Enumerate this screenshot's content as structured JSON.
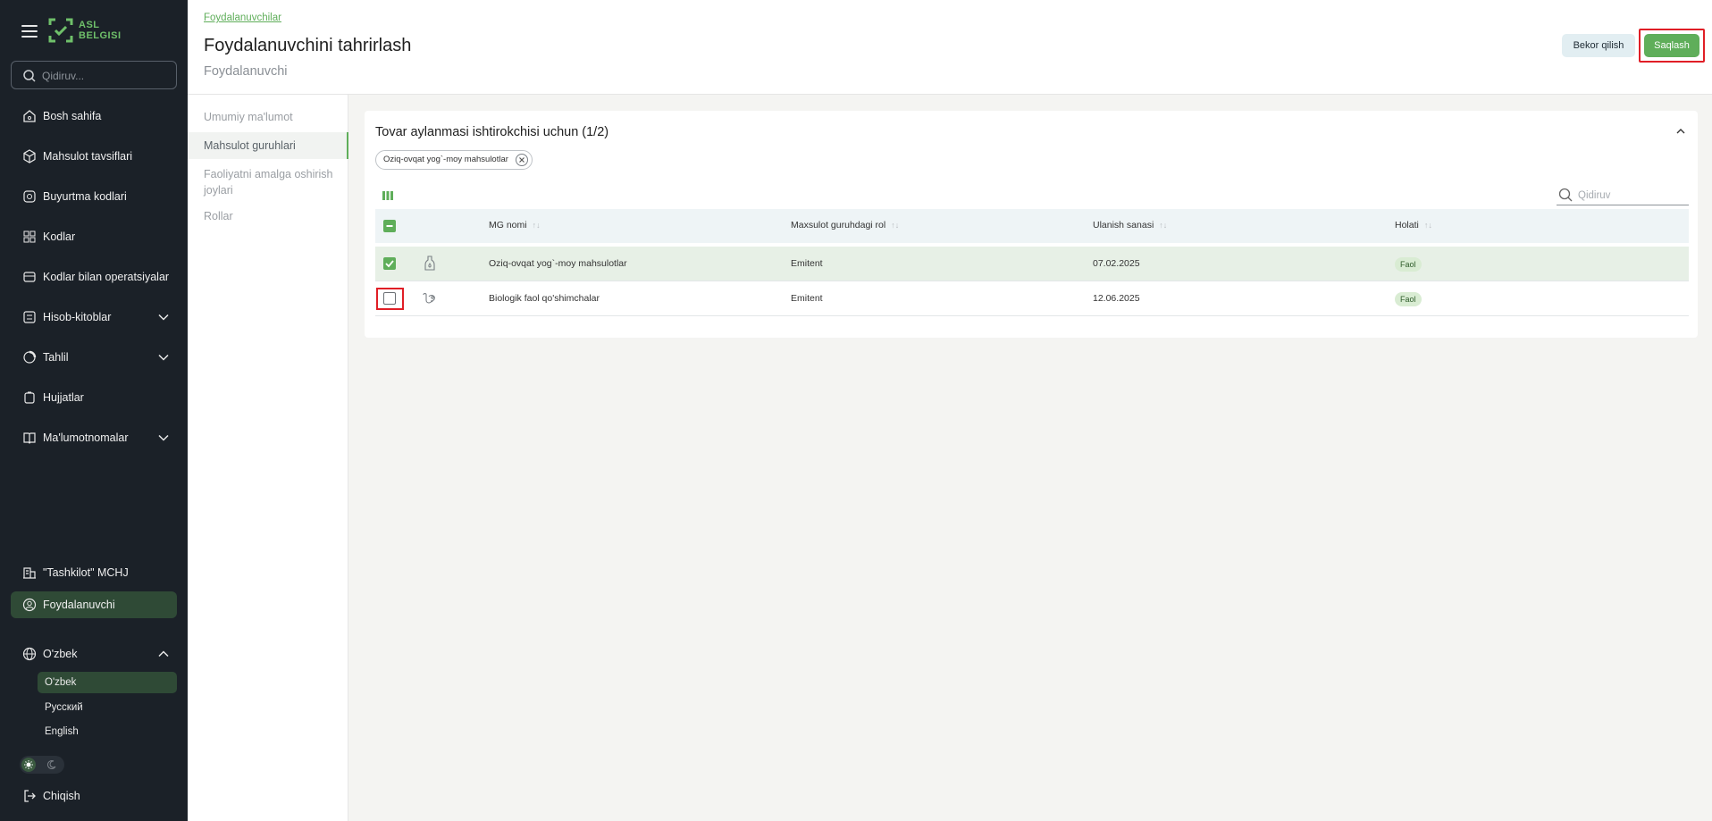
{
  "sidebar": {
    "logo": {
      "line1": "ASL",
      "line2": "BELGISI"
    },
    "search_placeholder": "Qidiruv...",
    "items": [
      {
        "label": "Bosh sahifa"
      },
      {
        "label": "Mahsulot tavsiflari"
      },
      {
        "label": "Buyurtma kodlari"
      },
      {
        "label": "Kodlar"
      },
      {
        "label": "Kodlar bilan operatsiyalar"
      },
      {
        "label": "Hisob-kitoblar"
      },
      {
        "label": "Tahlil"
      },
      {
        "label": "Hujjatlar"
      },
      {
        "label": "Ma'lumotnomalar"
      }
    ],
    "organization": "\"Tashkilot\" MCHJ",
    "user": "Foydalanuvchi",
    "language": {
      "current": "O'zbek",
      "options": [
        "O'zbek",
        "Русский",
        "English"
      ]
    },
    "logout": "Chiqish"
  },
  "header": {
    "breadcrumb": "Foydalanuvchilar",
    "title": "Foydalanuvchini tahrirlash",
    "subtitle": "Foydalanuvchi",
    "cancel_label": "Bekor qilish",
    "save_label": "Saqlash"
  },
  "subnav": {
    "items": [
      {
        "label": "Umumiy ma'lumot"
      },
      {
        "label": "Mahsulot guruhlari"
      },
      {
        "label": "Faoliyatni amalga oshirish joylari"
      },
      {
        "label": "Rollar"
      }
    ]
  },
  "card": {
    "title": "Tovar aylanmasi ishtirokchisi uchun (1/2)",
    "filter_chip": "Oziq-ovqat yog`-moy mahsulotlar",
    "search_placeholder": "Qidiruv",
    "columns": [
      "MG nomi",
      "Maxsulot guruhdagi rol",
      "Ulanish sanasi",
      "Holati"
    ],
    "rows": [
      {
        "checked": true,
        "name": "Oziq-ovqat yog`-moy mahsulotlar",
        "role": "Emitent",
        "date": "07.02.2025",
        "status": "Faol"
      },
      {
        "checked": false,
        "name": "Biologik faol qo'shimchalar",
        "role": "Emitent",
        "date": "12.06.2025",
        "status": "Faol"
      }
    ]
  },
  "colors": {
    "accent": "#5fae5a",
    "sidebar_bg": "#1b2128",
    "highlight": "#e01e26"
  }
}
